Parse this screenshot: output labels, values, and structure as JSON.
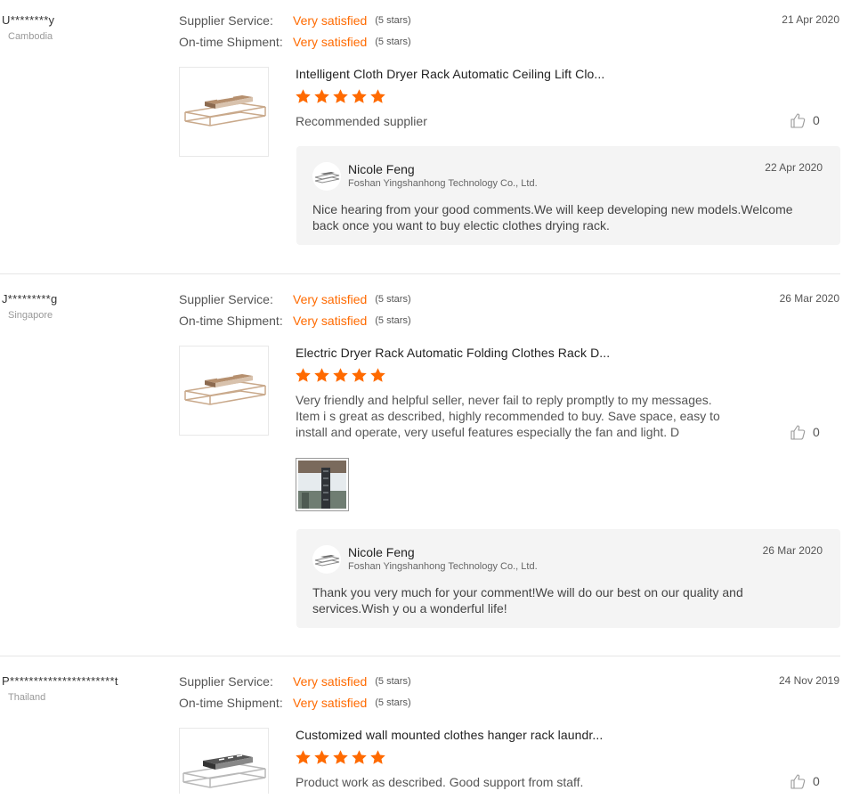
{
  "colors": {
    "accent": "#ff6a00",
    "reply_bg": "#f4f4f4"
  },
  "labels": {
    "supplier_service": "Supplier Service:",
    "ontime_shipment": "On-time Shipment:"
  },
  "reviews": [
    {
      "reviewer": "U********y",
      "country": "Cambodia",
      "supplier_service": "Very satisfied",
      "supplier_service_stars": "(5 stars)",
      "ontime_shipment": "Very satisfied",
      "ontime_shipment_stars": "(5 stars)",
      "date": "21 Apr 2020",
      "product_title": "Intelligent Cloth Dryer Rack Automatic Ceiling Lift Clo...",
      "rating": 5,
      "comment": "Recommended supplier",
      "likes": "0",
      "reply": {
        "name": "Nicole Feng",
        "company": "Foshan Yingshanhong Technology Co., Ltd.",
        "date": "22 Apr 2020",
        "text": "Nice hearing from your good comments.We will keep developing new models.Welcome back once you want to buy electic clothes drying rack."
      }
    },
    {
      "reviewer": "J*********g",
      "country": "Singapore",
      "supplier_service": "Very satisfied",
      "supplier_service_stars": "(5 stars)",
      "ontime_shipment": "Very satisfied",
      "ontime_shipment_stars": "(5 stars)",
      "date": "26 Mar 2020",
      "product_title": "Electric Dryer Rack Automatic Folding Clothes Rack D...",
      "rating": 5,
      "comment": "Very friendly and helpful seller, never fail to reply promptly to my messages. Item i s great as described, highly recommended to buy. Save space, easy to install and operate, very useful features especially the fan and light. D",
      "likes": "0",
      "reply": {
        "name": "Nicole Feng",
        "company": "Foshan Yingshanhong Technology Co., Ltd.",
        "date": "26 Mar 2020",
        "text": "Thank you very much for your comment!We will do our best on our quality and services.Wish y ou a wonderful life!"
      }
    },
    {
      "reviewer": "P**********************t",
      "country": "Thailand",
      "supplier_service": "Very satisfied",
      "supplier_service_stars": "(5 stars)",
      "ontime_shipment": "Very satisfied",
      "ontime_shipment_stars": "(5 stars)",
      "date": "24 Nov 2019",
      "product_title": "Customized wall mounted clothes hanger rack laundr...",
      "rating": 5,
      "comment": "Product work as described. Good support from staff.",
      "likes": "0"
    }
  ]
}
